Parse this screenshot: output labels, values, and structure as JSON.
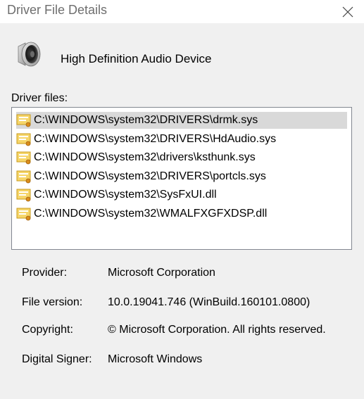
{
  "window": {
    "title": "Driver File Details",
    "close_icon": "close-icon"
  },
  "device": {
    "icon": "speaker-icon",
    "name": "High Definition Audio Device"
  },
  "driver_files": {
    "label": "Driver files:",
    "items": [
      {
        "path": "C:\\WINDOWS\\system32\\DRIVERS\\drmk.sys",
        "selected": true
      },
      {
        "path": "C:\\WINDOWS\\system32\\DRIVERS\\HdAudio.sys",
        "selected": false
      },
      {
        "path": "C:\\WINDOWS\\system32\\drivers\\ksthunk.sys",
        "selected": false
      },
      {
        "path": "C:\\WINDOWS\\system32\\DRIVERS\\portcls.sys",
        "selected": false
      },
      {
        "path": "C:\\WINDOWS\\system32\\SysFxUI.dll",
        "selected": false
      },
      {
        "path": "C:\\WINDOWS\\system32\\WMALFXGFXDSP.dll",
        "selected": false
      }
    ]
  },
  "details": {
    "provider_label": "Provider:",
    "provider_value": "Microsoft Corporation",
    "version_label": "File version:",
    "version_value": "10.0.19041.746 (WinBuild.160101.0800)",
    "copyright_label": "Copyright:",
    "copyright_value": "© Microsoft Corporation. All rights reserved.",
    "signer_label": "Digital Signer:",
    "signer_value": "Microsoft Windows"
  }
}
